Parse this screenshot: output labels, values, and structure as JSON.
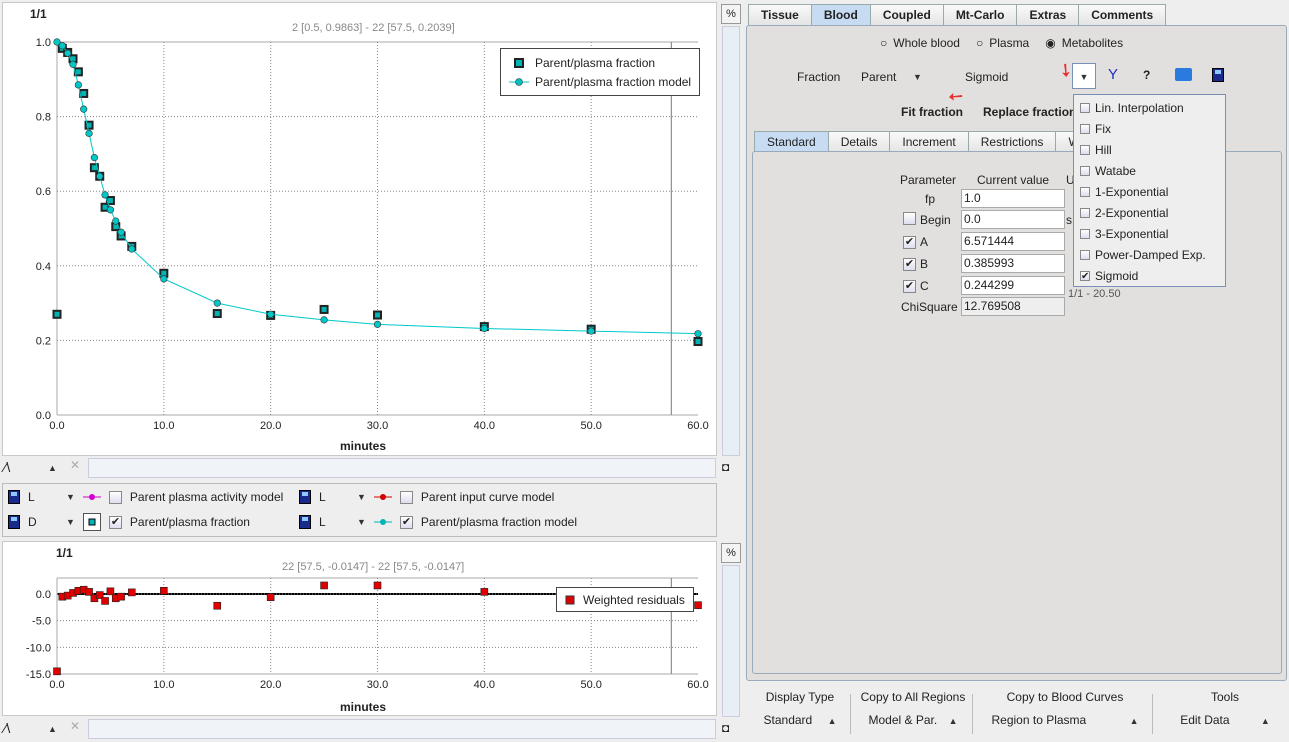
{
  "top_plot": {
    "page": "1/1",
    "cursor": "2 [0.5, 0.9863] - 22 [57.5, 0.2039]",
    "xlabel": "minutes",
    "pct": "%",
    "xticks": [
      "0.0",
      "10.0",
      "20.0",
      "30.0",
      "40.0",
      "50.0",
      "60.0"
    ],
    "yticks": [
      "0.0",
      "0.2",
      "0.4",
      "0.6",
      "0.8",
      "1.0"
    ],
    "legend": [
      "Parent/plasma fraction",
      "Parent/plasma fraction model"
    ]
  },
  "chart_data": [
    {
      "type": "scatter",
      "xlabel": "minutes",
      "xlim": [
        0,
        60
      ],
      "ylim": [
        0,
        1.0
      ],
      "grid": true,
      "legend": "top-right",
      "series": [
        {
          "name": "Parent/plasma fraction",
          "marker": "square",
          "color": "#00b4b4",
          "x": [
            0,
            0.5,
            1,
            1.5,
            2,
            2.5,
            3,
            3.5,
            4,
            4.5,
            5,
            5.5,
            6,
            7,
            10,
            15,
            20,
            25,
            30,
            40,
            50,
            60
          ],
          "y": [
            0.27,
            0.983,
            0.972,
            0.955,
            0.92,
            0.862,
            0.777,
            0.663,
            0.64,
            0.557,
            0.575,
            0.505,
            0.48,
            0.452,
            0.38,
            0.272,
            0.267,
            0.283,
            0.268,
            0.237,
            0.23,
            0.197
          ]
        },
        {
          "name": "Parent/plasma fraction model",
          "marker": "circle",
          "line": true,
          "color": "#00c8c8",
          "x": [
            0,
            0.5,
            1,
            1.5,
            2,
            2.5,
            3,
            3.5,
            4,
            4.5,
            5,
            5.5,
            6,
            7,
            10,
            15,
            20,
            25,
            30,
            40,
            50,
            60
          ],
          "y": [
            1.0,
            0.99,
            0.97,
            0.94,
            0.885,
            0.82,
            0.755,
            0.69,
            0.64,
            0.59,
            0.55,
            0.52,
            0.49,
            0.445,
            0.365,
            0.3,
            0.27,
            0.255,
            0.243,
            0.232,
            0.225,
            0.218
          ]
        }
      ]
    },
    {
      "type": "scatter",
      "xlabel": "minutes",
      "xlim": [
        0,
        60
      ],
      "ylim": [
        -15,
        3
      ],
      "grid": true,
      "legend": "top-right",
      "series": [
        {
          "name": "Weighted residuals",
          "marker": "square",
          "color": "#e00000",
          "x": [
            0,
            0.5,
            1,
            1.5,
            2,
            2.5,
            3,
            3.5,
            4,
            4.5,
            5,
            5.5,
            6,
            7,
            10,
            15,
            20,
            25,
            30,
            40,
            50,
            60
          ],
          "y": [
            -14.5,
            -0.5,
            -0.3,
            0.2,
            0.6,
            0.8,
            0.4,
            -0.8,
            -0.2,
            -1.3,
            0.5,
            -0.8,
            -0.5,
            0.3,
            0.6,
            -2.2,
            -0.6,
            1.6,
            1.6,
            0.4,
            0.2,
            -2.1
          ]
        }
      ]
    }
  ],
  "res_plot": {
    "page": "1/1",
    "cursor": "22 [57.5, -0.0147] - 22 [57.5, -0.0147]",
    "xlabel": "minutes",
    "pct": "%",
    "xticks": [
      "0.0",
      "10.0",
      "20.0",
      "30.0",
      "40.0",
      "50.0",
      "60.0"
    ],
    "yticks": [
      "0.0",
      "-5.0",
      "-10.0",
      "-15.0"
    ],
    "legend": "Weighted residuals"
  },
  "curves": [
    {
      "style": "L",
      "label": "Parent plasma activity model",
      "checked": false,
      "color": "#d000d0"
    },
    {
      "style": "L",
      "label": "Parent input curve model",
      "checked": false,
      "color": "#d00000"
    },
    {
      "style": "D",
      "label": "Parent/plasma fraction",
      "checked": true,
      "color": "#00b4b4"
    },
    {
      "style": "L",
      "label": "Parent/plasma fraction model",
      "checked": true,
      "color": "#00b4b4"
    }
  ],
  "tabs": [
    "Tissue",
    "Blood",
    "Coupled",
    "Mt-Carlo",
    "Extras",
    "Comments"
  ],
  "radios": [
    "Whole blood",
    "Plasma",
    "Metabolites"
  ],
  "fraction_label": "Fraction",
  "fraction_value": "Parent",
  "model_name": "Sigmoid",
  "help": "?",
  "fit_button": "Fit fraction",
  "replace_button": "Replace fraction",
  "subtabs": [
    "Standard",
    "Details",
    "Increment",
    "Restrictions",
    "We"
  ],
  "params": {
    "h_param": "Parameter",
    "h_value": "Current value",
    "h_unit": "U",
    "rows": [
      {
        "name": "fp",
        "value": "1.0"
      },
      {
        "name": "Begin",
        "value": "0.0",
        "unit": "s",
        "checked": false
      },
      {
        "name": "A",
        "value": "6.571444",
        "checked": true
      },
      {
        "name": "B",
        "value": "0.385993",
        "checked": true
      },
      {
        "name": "C",
        "value": "0.244299",
        "checked": true,
        "unit": "1/1 - 20.50"
      }
    ],
    "chisq_label": "ChiSquare",
    "chisq": "12.769508"
  },
  "model_menu": [
    {
      "label": "Lin. Interpolation",
      "checked": false
    },
    {
      "label": "Fix",
      "checked": false
    },
    {
      "label": "Hill",
      "checked": false
    },
    {
      "label": "Watabe",
      "checked": false
    },
    {
      "label": "1-Exponential",
      "checked": false
    },
    {
      "label": "2-Exponential",
      "checked": false
    },
    {
      "label": "3-Exponential",
      "checked": false
    },
    {
      "label": "Power-Damped Exp.",
      "checked": false
    },
    {
      "label": "Sigmoid",
      "checked": true
    }
  ],
  "bottom": [
    {
      "title": "Display Type",
      "value": "Standard"
    },
    {
      "title": "Copy to All Regions",
      "value": "Model & Par."
    },
    {
      "title": "Copy to Blood Curves",
      "value": "Region to Plasma"
    },
    {
      "title": "Tools",
      "value": "Edit Data"
    }
  ]
}
